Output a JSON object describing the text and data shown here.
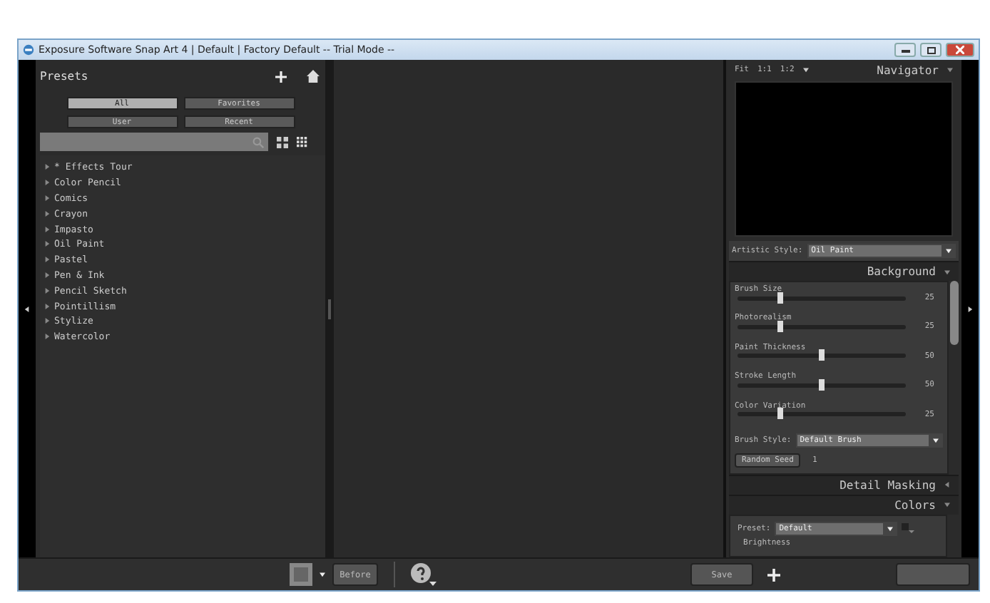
{
  "window": {
    "title": "Exposure Software Snap Art 4 | Default | Factory Default -- Trial Mode --"
  },
  "presets": {
    "title": "Presets",
    "filters": [
      {
        "label": "All",
        "selected": true
      },
      {
        "label": "Favorites",
        "selected": false
      },
      {
        "label": "User",
        "selected": false
      },
      {
        "label": "Recent",
        "selected": false
      }
    ],
    "items": [
      "* Effects Tour",
      "Color Pencil",
      "Comics",
      "Crayon",
      "Impasto",
      "Oil Paint",
      "Pastel",
      "Pen & Ink",
      "Pencil Sketch",
      "Pointillism",
      "Stylize",
      "Watercolor"
    ]
  },
  "navigator": {
    "zoom": [
      "Fit",
      "1:1",
      "1:2"
    ],
    "title": "Navigator"
  },
  "artistic_style": {
    "label": "Artistic Style:",
    "value": "Oil Paint"
  },
  "background": {
    "title": "Background",
    "sliders": [
      {
        "name": "Brush Size",
        "level": 0.25,
        "reading": "25"
      },
      {
        "name": "Photorealism",
        "level": 0.25,
        "reading": "25"
      },
      {
        "name": "Paint Thickness",
        "level": 0.5,
        "reading": "50"
      },
      {
        "name": "Stroke Length",
        "level": 0.5,
        "reading": "50"
      },
      {
        "name": "Color Variation",
        "level": 0.25,
        "reading": "25"
      }
    ],
    "brush_style": {
      "label": "Brush Style:",
      "value": "Default Brush"
    },
    "random_seed": {
      "button": "Random Seed",
      "value": "1"
    }
  },
  "sections": [
    {
      "title": "Detail Masking",
      "expanded": false
    },
    {
      "title": "Colors",
      "expanded": true
    }
  ],
  "colors": {
    "preset_label": "Preset:",
    "preset_value": "Default",
    "brightness": "Brightness"
  },
  "bottom_bar": {
    "before": "Before",
    "save": "Save"
  }
}
